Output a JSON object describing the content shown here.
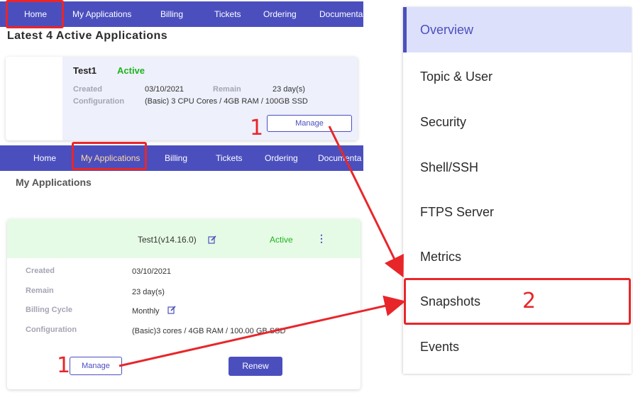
{
  "nav_items": [
    {
      "label": "Home"
    },
    {
      "label": "My Applications"
    },
    {
      "label": "Billing"
    },
    {
      "label": "Tickets"
    },
    {
      "label": "Ordering"
    },
    {
      "label": "Documenta"
    }
  ],
  "dashboard": {
    "title": "Latest 4 Active Applications",
    "card": {
      "name": "Test1",
      "status": "Active",
      "created_label": "Created",
      "created_value": "03/10/2021",
      "remain_label": "Remain",
      "remain_value": "23 day(s)",
      "config_label": "Configuration",
      "config_value": "(Basic) 3 CPU Cores / 4GB RAM / 100GB SSD",
      "manage_label": "Manage"
    }
  },
  "my_applications": {
    "title": "My Applications",
    "card": {
      "name": "Test1(v14.16.0)",
      "status": "Active",
      "menu_glyph": "⋮",
      "rows": [
        {
          "label": "Created",
          "value": "03/10/2021"
        },
        {
          "label": "Remain",
          "value": "23 day(s)"
        },
        {
          "label": "Billing Cycle",
          "value": "Monthly"
        },
        {
          "label": "Configuration",
          "value": "(Basic)3 cores / 4GB RAM / 100.00 GB SSD"
        }
      ],
      "manage_label": "Manage",
      "renew_label": "Renew"
    }
  },
  "sidebar": {
    "items": [
      {
        "label": "Overview",
        "active": true
      },
      {
        "label": "Topic & User"
      },
      {
        "label": "Security"
      },
      {
        "label": "Shell/SSH"
      },
      {
        "label": "FTPS Server"
      },
      {
        "label": "Metrics"
      },
      {
        "label": "Snapshots"
      },
      {
        "label": "Events"
      }
    ]
  },
  "annotations": {
    "step1_top": "1",
    "step1_bottom": "1",
    "step2": "2"
  },
  "colors": {
    "nav_bg": "#4b4fbe",
    "accent": "#4b4fbe",
    "highlight": "#e8262a",
    "status_active": "#1db41d",
    "sidebar_active_bg": "#dde0fb"
  }
}
